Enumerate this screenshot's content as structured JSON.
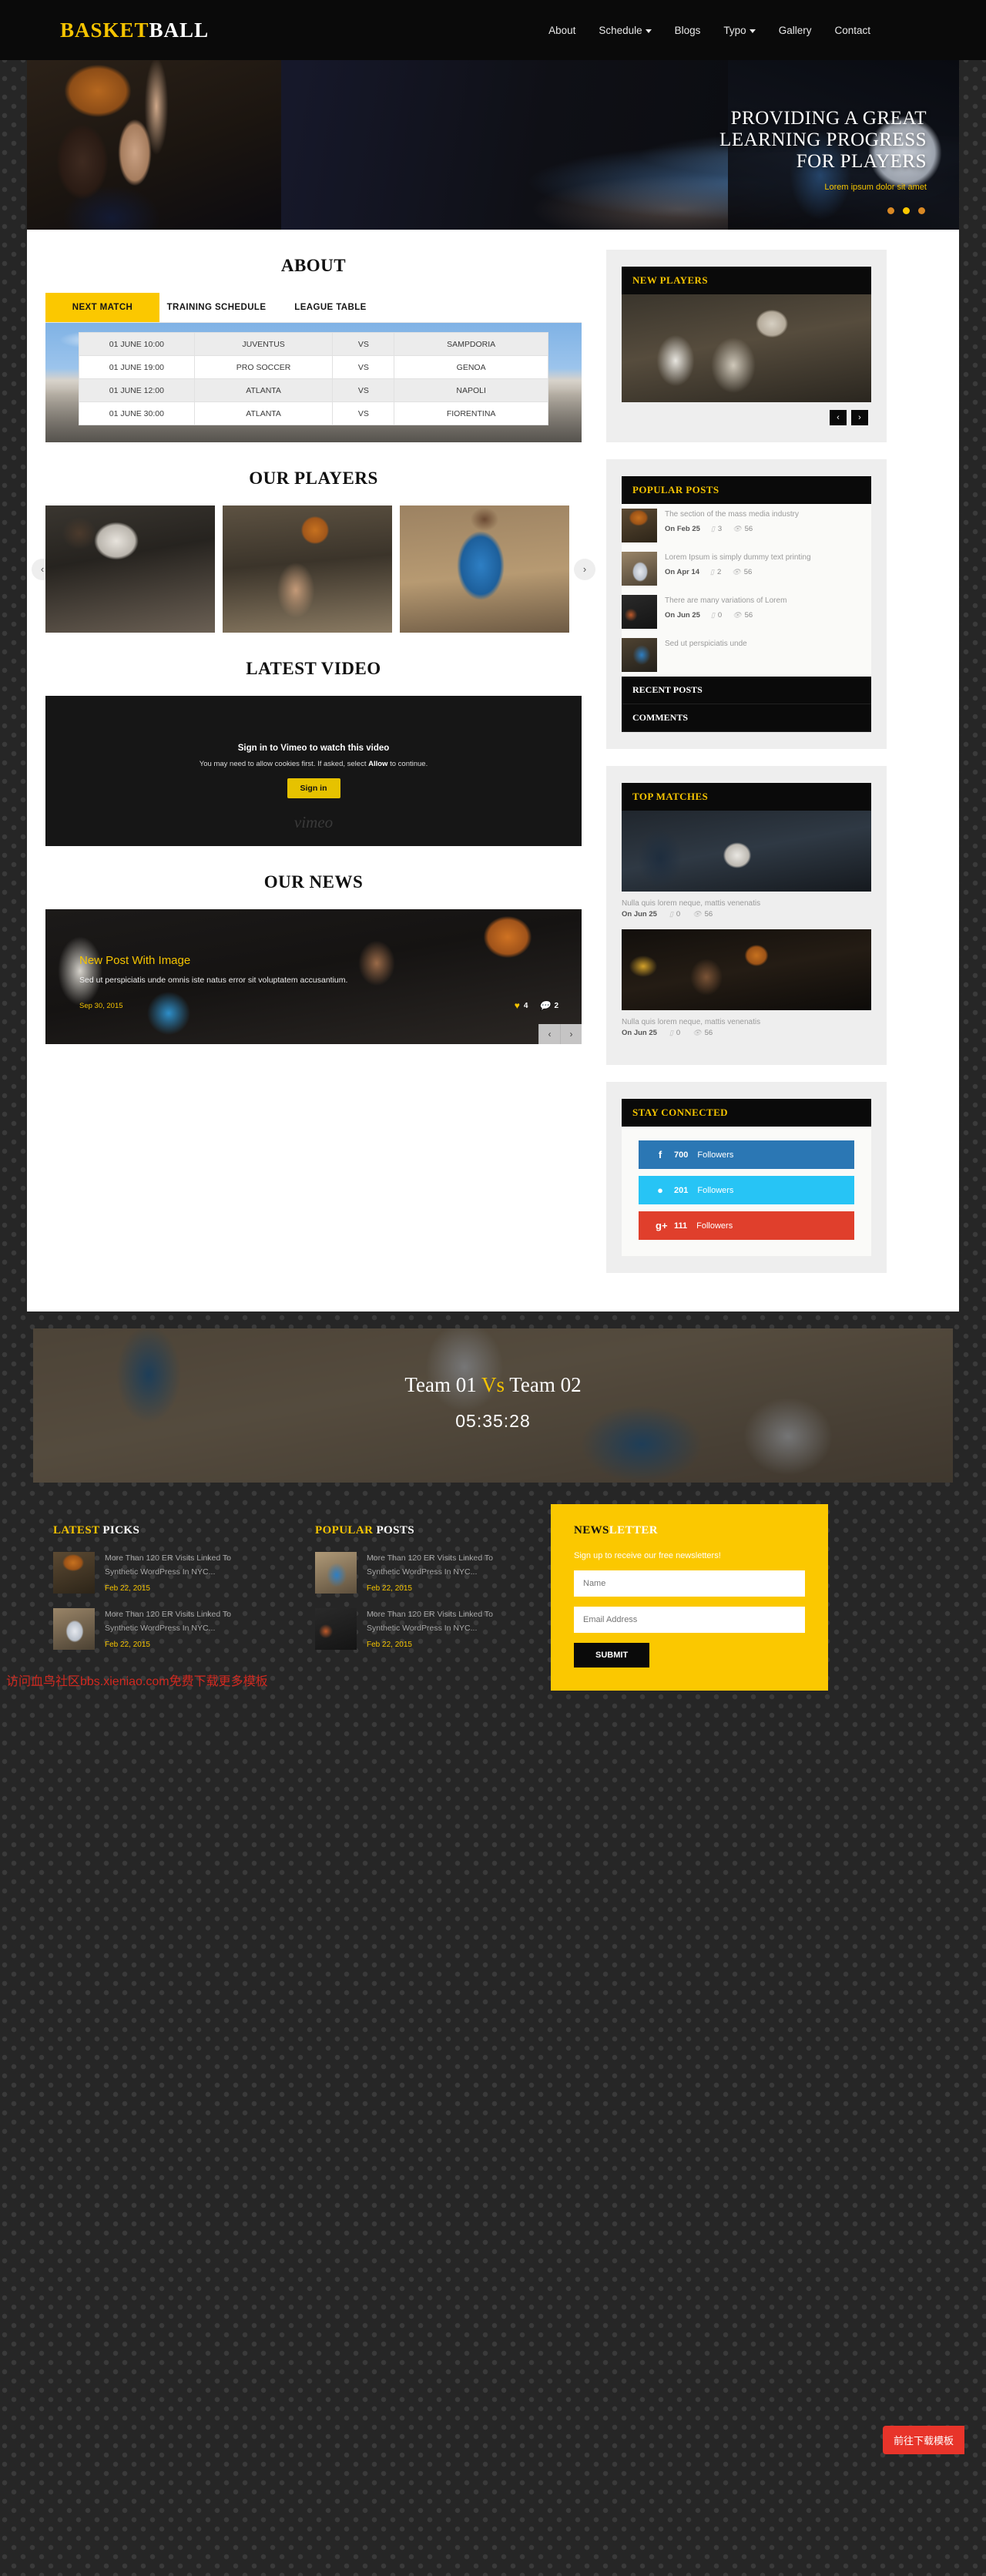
{
  "header": {
    "logo_first": "BASKET",
    "logo_second": "BALL",
    "nav": [
      {
        "label": "About",
        "caret": false
      },
      {
        "label": "Schedule",
        "caret": true
      },
      {
        "label": "Blogs",
        "caret": false
      },
      {
        "label": "Typo",
        "caret": true
      },
      {
        "label": "Gallery",
        "caret": false
      },
      {
        "label": "Contact",
        "caret": false
      }
    ]
  },
  "hero": {
    "line1": "PROVIDING A GREAT",
    "line2": "LEARNING PROGRESS",
    "line3": "FOR PLAYERS",
    "subtitle": "Lorem ipsum dolor sit amet",
    "dots": 3,
    "active_dot": 2
  },
  "about": {
    "title": "ABOUT",
    "tabs": [
      {
        "label": "NEXT MATCH",
        "active": true
      },
      {
        "label": "TRAINING SCHEDULE",
        "active": false
      },
      {
        "label": "LEAGUE TABLE",
        "active": false
      }
    ],
    "matches": [
      {
        "time": "01 JUNE 10:00",
        "home": "JUVENTUS",
        "vs": "VS",
        "away": "SAMPDORIA"
      },
      {
        "time": "01 JUNE 19:00",
        "home": "PRO SOCCER",
        "vs": "VS",
        "away": "GENOA"
      },
      {
        "time": "01 JUNE 12:00",
        "home": "ATLANTA",
        "vs": "VS",
        "away": "NAPOLI"
      },
      {
        "time": "01 JUNE 30:00",
        "home": "ATLANTA",
        "vs": "VS",
        "away": "FIORENTINA"
      }
    ]
  },
  "players": {
    "title": "OUR PLAYERS",
    "prev": "‹",
    "next": "›"
  },
  "video": {
    "title": "LATEST VIDEO",
    "heading": "Sign in to Vimeo to watch this video",
    "note_a": "You may need to allow cookies first. If asked, select ",
    "note_b": "Allow",
    "note_c": " to continue.",
    "button": "Sign in",
    "brand": "vimeo"
  },
  "news": {
    "title": "OUR NEWS",
    "post_title": "New Post With Image",
    "post_desc": "Sed ut perspiciatis unde omnis iste natus error sit voluptatem accusantium.",
    "post_date": "Sep 30, 2015",
    "likes": "4",
    "comments": "2",
    "prev": "‹",
    "next": "›"
  },
  "sidebar": {
    "new_players": {
      "heading": "NEW PLAYERS",
      "prev": "‹",
      "next": "›"
    },
    "popular_posts": {
      "heading": "POPULAR POSTS",
      "items": [
        {
          "title": "The section of the mass media industry",
          "date": "On Feb 25",
          "comments": "3",
          "views": "56"
        },
        {
          "title": "Lorem Ipsum is simply dummy text printing",
          "date": "On Apr 14",
          "comments": "2",
          "views": "56"
        },
        {
          "title": "There are many variations of Lorem",
          "date": "On Jun 25",
          "comments": "0",
          "views": "56"
        },
        {
          "title": "Sed ut perspiciatis unde",
          "date": "",
          "comments": "",
          "views": ""
        }
      ],
      "tabs": [
        "RECENT POSTS",
        "COMMENTS"
      ]
    },
    "top_matches": {
      "heading": "TOP MATCHES",
      "items": [
        {
          "caption": "Nulla quis lorem neque, mattis venenatis",
          "date": "On Jun 25",
          "comments": "0",
          "views": "56"
        },
        {
          "caption": "Nulla quis lorem neque, mattis venenatis",
          "date": "On Jun 25",
          "comments": "0",
          "views": "56"
        }
      ]
    },
    "stay_connected": {
      "heading": "STAY CONNECTED",
      "items": [
        {
          "network": "facebook",
          "icon": "f",
          "count": "700",
          "label": "Followers",
          "color": "#2b77b4"
        },
        {
          "network": "twitter",
          "icon": "t",
          "count": "201",
          "label": "Followers",
          "color": "#27c4f5"
        },
        {
          "network": "google-plus",
          "icon": "g+",
          "count": "111",
          "label": "Followers",
          "color": "#e03f2c"
        }
      ]
    }
  },
  "banner": {
    "team_one": "Team 01",
    "vs": "Vs",
    "team_two": "Team 02",
    "countdown": "05:35:28"
  },
  "footer": {
    "latest_picks": {
      "title_first": "LATEST",
      "title_second": " PICKS",
      "items": [
        {
          "title": "More Than 120 ER Visits Linked To Synthetic WordPress In NYC...",
          "date": "Feb 22, 2015"
        },
        {
          "title": "More Than 120 ER Visits Linked To Synthetic WordPress In NYC...",
          "date": "Feb 22, 2015"
        }
      ]
    },
    "popular_posts": {
      "title_first": "POPULAR",
      "title_second": " POSTS",
      "items": [
        {
          "title": "More Than 120 ER Visits Linked To Synthetic WordPress In NYC...",
          "date": "Feb 22, 2015"
        },
        {
          "title": "More Than 120 ER Visits Linked To Synthetic WordPress In NYC...",
          "date": "Feb 22, 2015"
        }
      ]
    },
    "newsletter": {
      "title_first": "NEWS",
      "title_second": "LETTER",
      "subtitle": "Sign up to receive our free newsletters!",
      "name_placeholder": "Name",
      "email_placeholder": "Email Address",
      "submit": "SUBMIT"
    }
  },
  "overlay": {
    "watermark": "访问血鸟社区bbs.xieniao.com免费下载更多模板",
    "download_badge": "前往下载模板"
  },
  "colors": {
    "accent": "#fbc800",
    "dark": "#0a0a0a",
    "facebook": "#2b77b4",
    "twitter": "#27c4f5",
    "googleplus": "#e03f2c"
  }
}
